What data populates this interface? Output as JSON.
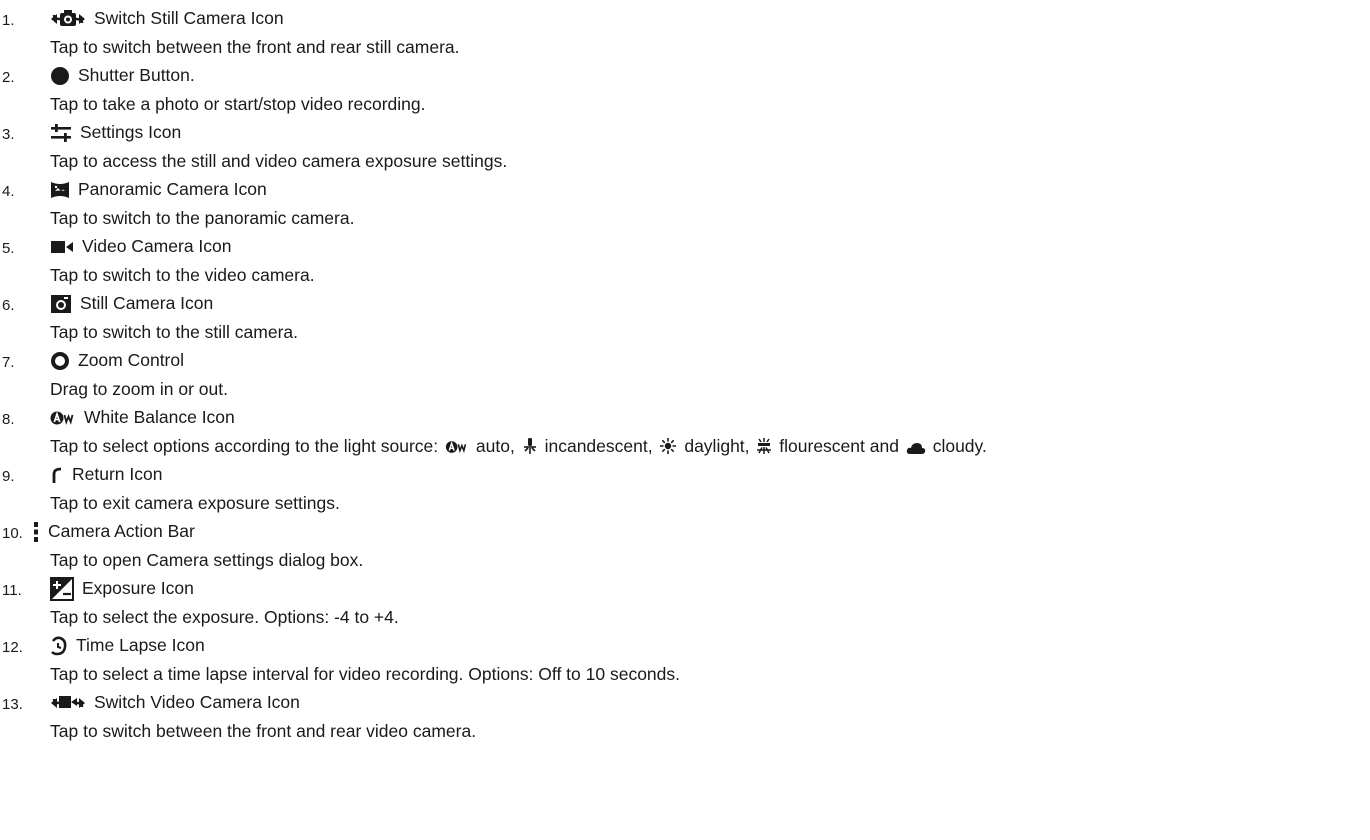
{
  "items": [
    {
      "number": "1.",
      "icon": "switch-still-camera-icon",
      "title": "Switch Still Camera Icon",
      "description": "Tap to switch between the front and rear still camera."
    },
    {
      "number": "2.",
      "icon": "shutter-button-icon",
      "title": "Shutter Button.",
      "description": "Tap to take a photo or start/stop video recording."
    },
    {
      "number": "3.",
      "icon": "settings-icon",
      "title": "Settings Icon",
      "description": "Tap to access the still and video camera exposure settings."
    },
    {
      "number": "4.",
      "icon": "panoramic-camera-icon",
      "title": "Panoramic Camera Icon",
      "description": "Tap to switch to the panoramic camera."
    },
    {
      "number": "5.",
      "icon": "video-camera-icon",
      "title": "Video Camera Icon",
      "description": "Tap to switch to the video camera."
    },
    {
      "number": "6.",
      "icon": "still-camera-icon",
      "title": "Still Camera Icon",
      "description": "Tap to switch to the still camera."
    },
    {
      "number": "7.",
      "icon": "zoom-control-icon",
      "title": "Zoom Control",
      "description": "Drag to zoom in or out."
    },
    {
      "number": "8.",
      "icon": "white-balance-icon",
      "title": "White Balance Icon",
      "description_parts": {
        "lead": "Tap to select options according to the light source:",
        "auto": "auto,",
        "incandescent": "incandescent,",
        "daylight": "daylight,",
        "fluorescent": "flourescent and",
        "cloudy": "cloudy."
      }
    },
    {
      "number": "9.",
      "icon": "return-icon",
      "title": "Return Icon",
      "description": "Tap to exit camera exposure settings."
    },
    {
      "number": "10.",
      "icon": "camera-action-bar-icon",
      "title": "Camera Action Bar",
      "description": "Tap to open Camera settings dialog box."
    },
    {
      "number": "11.",
      "icon": "exposure-icon",
      "title": "Exposure Icon",
      "description": "Tap to select the exposure. Options: -4 to +4."
    },
    {
      "number": "12.",
      "icon": "time-lapse-icon",
      "title": "Time Lapse Icon",
      "description": "Tap to select a time lapse interval for video recording. Options: Off to 10 seconds."
    },
    {
      "number": "13.",
      "icon": "switch-video-camera-icon",
      "title": "Switch Video Camera Icon",
      "description": "Tap to switch between the front and rear video camera."
    }
  ],
  "colors": {
    "text": "#1a1a1a",
    "icon": "#1a1a1a"
  }
}
